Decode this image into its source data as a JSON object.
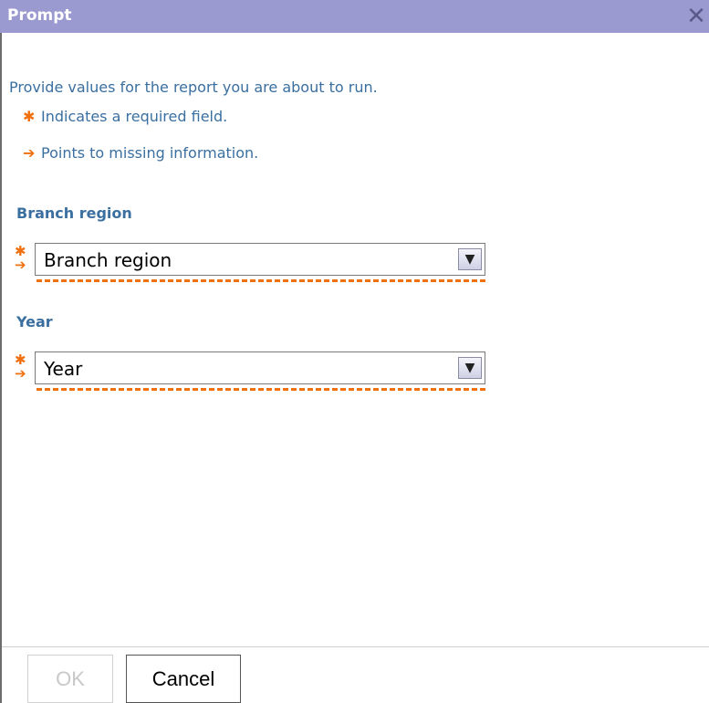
{
  "dialog": {
    "title": "Prompt",
    "close_icon": "close-icon"
  },
  "intro": {
    "text": "Provide values for the report you are about to run.",
    "legend": [
      {
        "mark": "✱",
        "icon": "required-asterisk-icon",
        "text": "Indicates a required field."
      },
      {
        "mark": "➔",
        "icon": "missing-arrow-icon",
        "text": "Points to missing information."
      }
    ]
  },
  "fields": [
    {
      "label": "Branch region",
      "value": "Branch region",
      "dropdown_icon": "chevron-down-icon"
    },
    {
      "label": "Year",
      "value": "Year",
      "dropdown_icon": "chevron-down-icon"
    }
  ],
  "footer": {
    "ok_label": "OK",
    "cancel_label": "Cancel"
  },
  "colors": {
    "titlebar": "#9a9ad0",
    "accent_text": "#3a6fa0",
    "required": "#f07010"
  }
}
